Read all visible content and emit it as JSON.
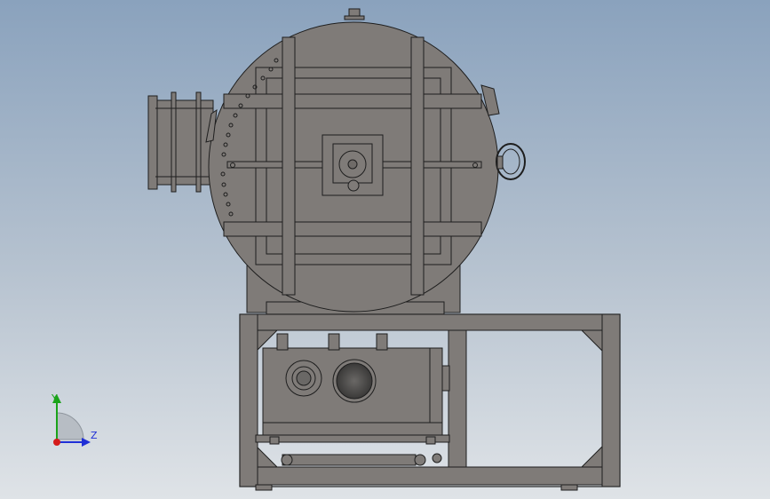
{
  "viewport": {
    "background_top": "#8aa2bd",
    "background_bottom": "#dfe3e7",
    "model_fill": "#7f7b78",
    "model_stroke": "#1e1e1e"
  },
  "triad": {
    "y_label": "Y",
    "z_label": "Z",
    "y_color": "#1aa31a",
    "z_color": "#1f2fd6",
    "x_color": "#d41b1b"
  }
}
